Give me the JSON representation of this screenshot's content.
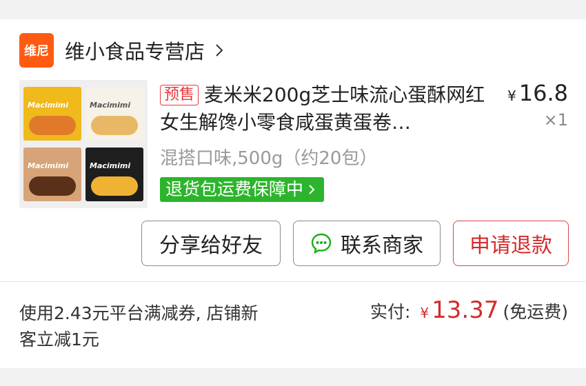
{
  "store": {
    "logo_text": "维尼",
    "name": "维小食品专营店",
    "logo_color": "#ff5a12",
    "chevron_icon": "chevron-right-icon"
  },
  "product": {
    "presale_tag": "预售",
    "title": "麦米米200g芝士味流心蛋酥网红女生解馋小零食咸蛋黄蛋卷…",
    "price_currency": "¥",
    "price": "16.8",
    "quantity": "×1",
    "variant": "混搭口味,500g（约20包）",
    "guarantee": "退货包运费保障中",
    "thumbnail_brand": "Macimimi"
  },
  "actions": {
    "share_label": "分享给好友",
    "contact_label": "联系商家",
    "refund_label": "申请退款"
  },
  "summary": {
    "coupon_text": "使用2.43元平台满减券, 店铺新客立减1元",
    "paid_label": "实付:",
    "paid_currency": "¥",
    "paid_amount": "13.37",
    "paid_note": "(免运费)"
  },
  "colors": {
    "accent_red": "#d42a2a",
    "guarantee_green": "#2cb52c"
  }
}
